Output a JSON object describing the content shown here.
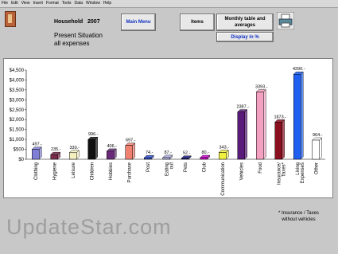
{
  "menu": [
    "File",
    "Edit",
    "View",
    "Insert",
    "Format",
    "Tools",
    "Data",
    "Window",
    "Help"
  ],
  "header": {
    "title": "Household",
    "year": "2007",
    "subtitle_line1": "Present Situation",
    "subtitle_line2": "all expenses"
  },
  "buttons": {
    "main_menu": "Main Menu",
    "items": "Items",
    "monthly_table": "Monthly table and averages",
    "display_percent": "Display in %"
  },
  "note": {
    "line1": "* Insurance / Taxes",
    "line2": "without vehicles"
  },
  "watermark": "UpdateStar.com",
  "chart_data": {
    "type": "bar",
    "categories": [
      "Clothing",
      "Hygiene",
      "Leisure",
      "Children",
      "Hobbies",
      "Purchase",
      "Post",
      "Eating out",
      "Pets",
      "Club",
      "Communication",
      "Vehicles",
      "Food",
      "Insurance/ Taxes*",
      "Living Expenses",
      "Other"
    ],
    "values": [
      497,
      235,
      330,
      996,
      406,
      697,
      74,
      87,
      52,
      80,
      343,
      2387,
      3393,
      1873,
      4290,
      964
    ],
    "data_labels": [
      "497.-",
      "235.-",
      "330.-",
      "996.-",
      "406.-",
      "697.-",
      "74.-",
      "87.-",
      "52.-",
      "80.-",
      "343.-",
      "2387.-",
      "3393.-",
      "1873.-",
      "4290.-",
      "964.-"
    ],
    "colors": [
      "#7f7fd8",
      "#7a2a4a",
      "#f4f0c0",
      "#101010",
      "#6a2a7a",
      "#f08070",
      "#3050d0",
      "#b0b0e0",
      "#1a1a7a",
      "#d000d0",
      "#f0f040",
      "#5a1a7a",
      "#f4a0c0",
      "#8a1020",
      "#2060f0",
      "#ffffff"
    ],
    "ylim": [
      0,
      4500
    ],
    "yticks": [
      "$0",
      "$500",
      "$1,000",
      "$1,500",
      "$2,000",
      "$2,500",
      "$3,000",
      "$3,500",
      "$4,000",
      "$4,500"
    ],
    "grid": false
  }
}
